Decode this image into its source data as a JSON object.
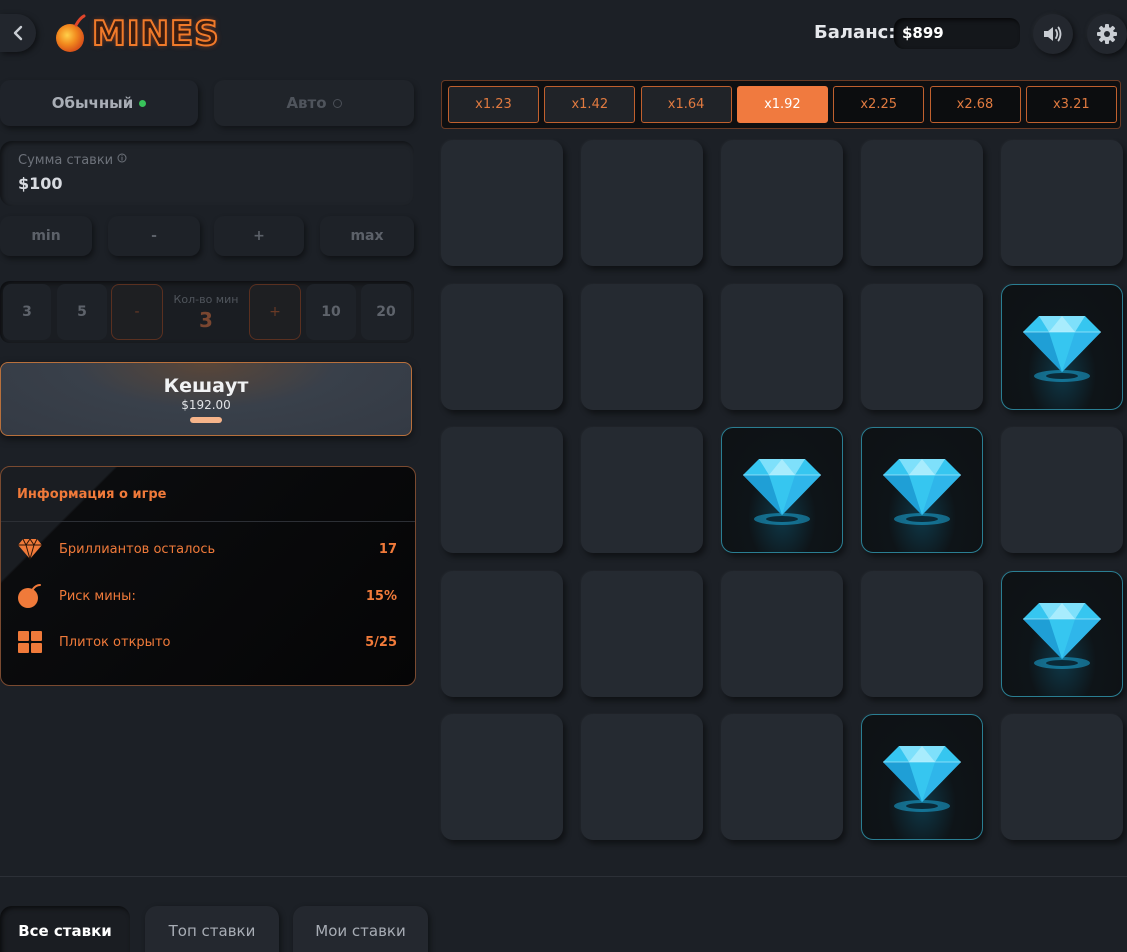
{
  "header": {
    "logo_text": "MINES",
    "balance_label": "Баланс:",
    "balance_value": "$899"
  },
  "modes": {
    "manual": "Обычный",
    "auto": "Авто"
  },
  "bet": {
    "label": "Сумма ставки",
    "value": "$100",
    "buttons": [
      "min",
      "-",
      "+",
      "max"
    ]
  },
  "mines": {
    "options_left": [
      "3",
      "5"
    ],
    "options_right": [
      "10",
      "20"
    ],
    "decrease": "-",
    "increase": "+",
    "label": "Кол-во мин",
    "value": "3"
  },
  "cashout": {
    "title": "Кешаут",
    "amount": "$192.00"
  },
  "info": {
    "title": "Информация о игре",
    "rows": [
      {
        "icon": "diamond-icon",
        "label": "Бриллиантов осталось",
        "value": "17"
      },
      {
        "icon": "bomb-icon",
        "label": "Риск мины:",
        "value": "15%"
      },
      {
        "icon": "grid-icon",
        "label": "Плиток открыто",
        "value": "5/25"
      }
    ]
  },
  "multipliers": {
    "values": [
      "x1.23",
      "x1.42",
      "x1.64",
      "x1.92",
      "x2.25",
      "x2.68",
      "x3.21"
    ],
    "current_index": 3
  },
  "grid": {
    "rows": 5,
    "cols": 5,
    "tiles": [
      "closed",
      "closed",
      "closed",
      "closed",
      "closed",
      "closed",
      "closed",
      "closed",
      "closed",
      "diamond",
      "closed",
      "closed",
      "diamond",
      "diamond",
      "closed",
      "closed",
      "closed",
      "closed",
      "closed",
      "diamond",
      "closed",
      "closed",
      "closed",
      "diamond",
      "closed"
    ]
  },
  "bottom_tabs": [
    "Все ставки",
    "Топ ставки",
    "Мои ставки"
  ],
  "colors": {
    "accent": "#f07a3f",
    "background": "#1c2026",
    "diamond": "#36c6f0"
  }
}
